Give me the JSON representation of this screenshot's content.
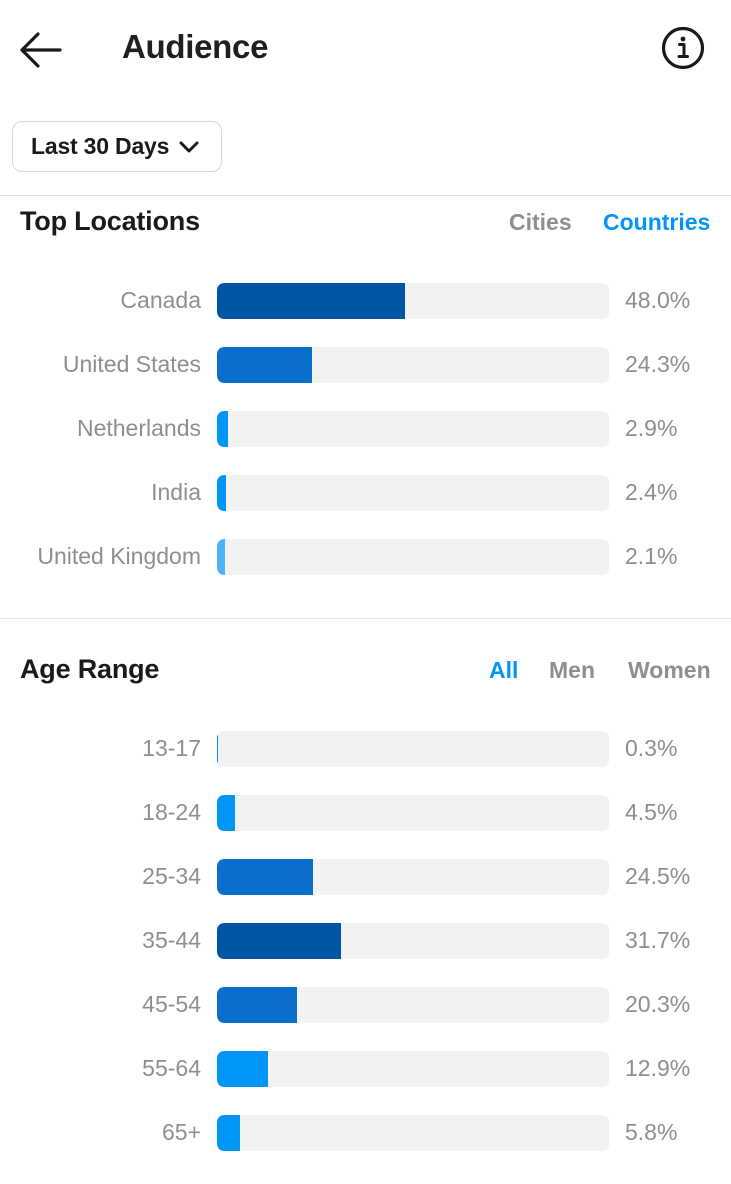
{
  "header": {
    "title": "Audience",
    "back_icon": "arrow-left-icon",
    "info_icon": "info-circle-icon"
  },
  "filter": {
    "selected": "Last 30 Days",
    "icon": "chevron-down-icon"
  },
  "colors": {
    "accent": "#0095f6",
    "bar_darkest": "#0055a4",
    "bar_dark": "#0a6fcc",
    "bar_bright": "#0095f6",
    "bar_light": "#4db3f8",
    "track": "#f2f2f2",
    "muted_text": "#8e8e8e"
  },
  "top_locations": {
    "title": "Top Locations",
    "tabs": [
      {
        "label": "Cities",
        "active": false
      },
      {
        "label": "Countries",
        "active": true
      }
    ]
  },
  "age_range": {
    "title": "Age Range",
    "tabs": [
      {
        "label": "All",
        "active": true
      },
      {
        "label": "Men",
        "active": false
      },
      {
        "label": "Women",
        "active": false
      }
    ]
  },
  "chart_data": [
    {
      "type": "bar",
      "orientation": "horizontal",
      "title": "Top Locations",
      "categories": [
        "Canada",
        "United States",
        "Netherlands",
        "India",
        "United Kingdom"
      ],
      "values": [
        48.0,
        24.3,
        2.9,
        2.4,
        2.1
      ],
      "value_labels": [
        "48.0%",
        "24.3%",
        "2.9%",
        "2.4%",
        "2.1%"
      ],
      "bar_colors": [
        "#0055a4",
        "#0a6fcc",
        "#0095f6",
        "#0095f6",
        "#4db3f8"
      ],
      "xlim": [
        0,
        100
      ],
      "unit": "%"
    },
    {
      "type": "bar",
      "orientation": "horizontal",
      "title": "Age Range",
      "categories": [
        "13-17",
        "18-24",
        "25-34",
        "35-44",
        "45-54",
        "55-64",
        "65+"
      ],
      "values": [
        0.3,
        4.5,
        24.5,
        31.7,
        20.3,
        12.9,
        5.8
      ],
      "value_labels": [
        "0.3%",
        "4.5%",
        "24.5%",
        "31.7%",
        "20.3%",
        "12.9%",
        "5.8%"
      ],
      "bar_colors": [
        "#0095f6",
        "#0095f6",
        "#0a6fcc",
        "#0055a4",
        "#0a6fcc",
        "#0095f6",
        "#0095f6"
      ],
      "xlim": [
        0,
        100
      ],
      "unit": "%"
    }
  ]
}
